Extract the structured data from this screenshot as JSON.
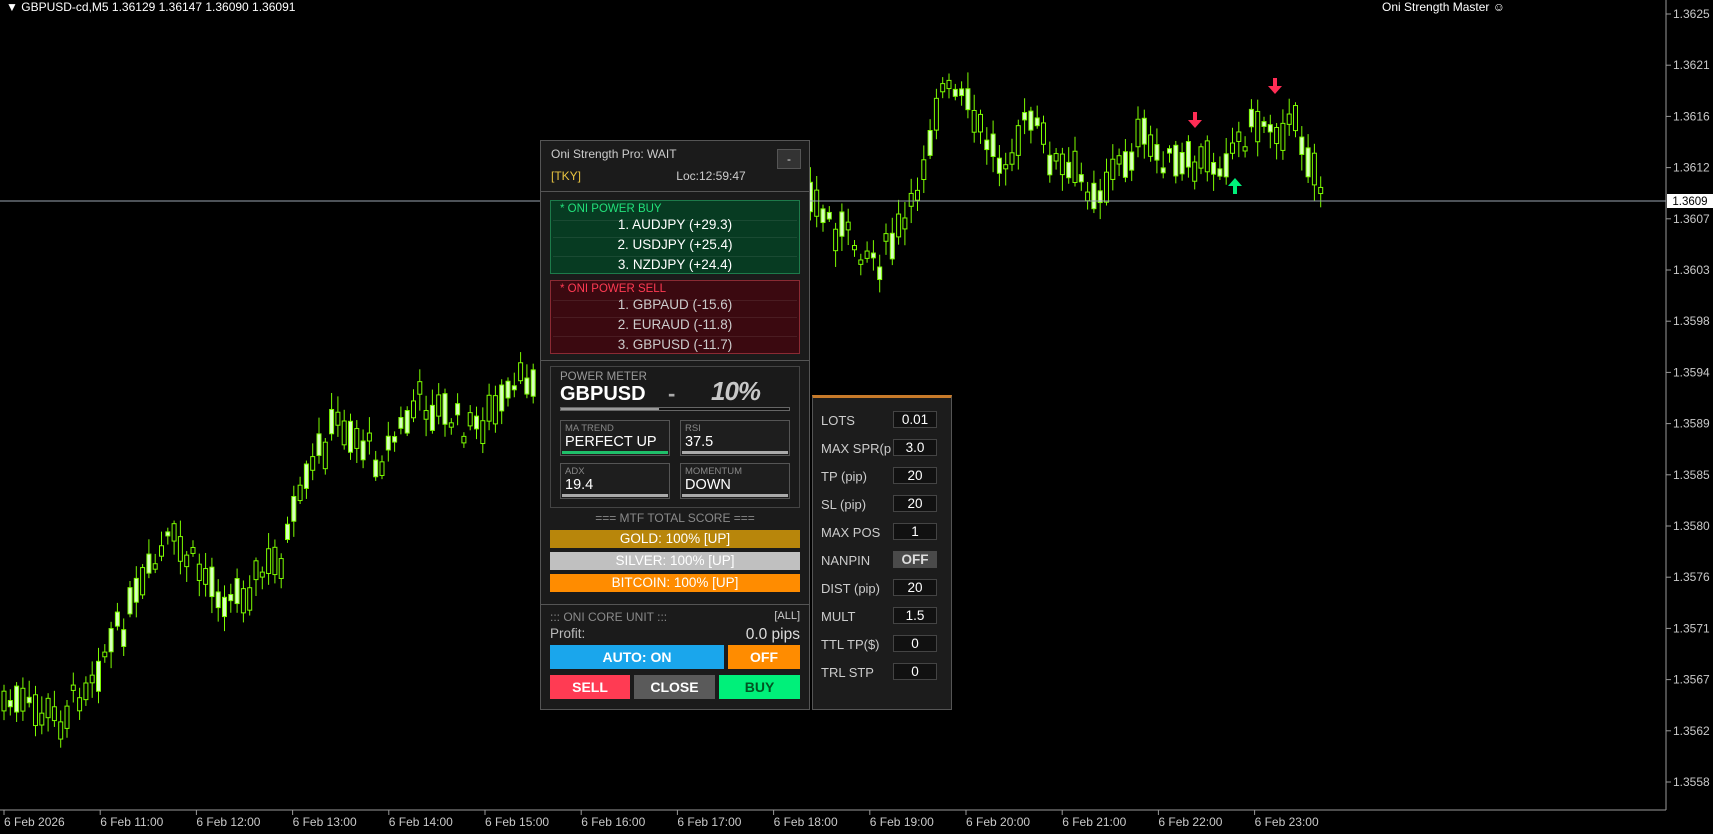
{
  "header": {
    "symbol_info": "GBPUSD-cd,M5  1.36129 1.36147 1.36090 1.36091",
    "ea_name": "Oni Strength Master ☺"
  },
  "price_axis": {
    "ticks": [
      "1.3625",
      "1.3621",
      "1.3616",
      "1.3612",
      "1.3607",
      "1.3603",
      "1.3598",
      "1.3594",
      "1.3589",
      "1.3585",
      "1.3580",
      "1.3576",
      "1.3571",
      "1.3567",
      "1.3562",
      "1.3558"
    ],
    "current": "1.3609"
  },
  "time_axis": {
    "ticks": [
      "6 Feb 2026",
      "6 Feb 11:00",
      "6 Feb 12:00",
      "6 Feb 13:00",
      "6 Feb 14:00",
      "6 Feb 15:00",
      "6 Feb 16:00",
      "6 Feb 17:00",
      "6 Feb 18:00",
      "6 Feb 19:00",
      "6 Feb 20:00",
      "6 Feb 21:00",
      "6 Feb 22:00",
      "6 Feb 23:00"
    ]
  },
  "colors": {
    "candle": "#7CFC00",
    "candle_body": "#d8ffc0",
    "sell_arrow": "#ff2d55",
    "buy_arrow": "#00f07a",
    "price_line": "#9aa4b0"
  },
  "panel": {
    "title": "Oni Strength Pro: WAIT",
    "minimize_label": "-",
    "session": "[TKY]",
    "clock": "Loc:12:59:47",
    "power_buy": {
      "title": "* ONI POWER BUY",
      "items": [
        "1. AUDJPY (+29.3)",
        "2. USDJPY (+25.4)",
        "3. NZDJPY (+24.4)"
      ]
    },
    "power_sell": {
      "title": "* ONI POWER SELL",
      "items": [
        "1. GBPAUD (-15.6)",
        "2. EURAUD (-11.8)",
        "3. GBPUSD (-11.7)"
      ]
    },
    "power_meter": {
      "label": "POWER METER",
      "symbol": "GBPUSD",
      "dash": "-",
      "value": "10%",
      "level": 0.43
    },
    "indicators": {
      "ma_trend": {
        "label": "MA TREND",
        "value": "PERFECT UP"
      },
      "rsi": {
        "label": "RSI",
        "value": "37.5"
      },
      "adx": {
        "label": "ADX",
        "value": "19.4"
      },
      "momentum": {
        "label": "MOMENTUM",
        "value": "DOWN"
      }
    },
    "mtf": {
      "title": "=== MTF TOTAL SCORE ===",
      "gold": "GOLD: 100% [UP]",
      "silver": "SILVER: 100% [UP]",
      "bitcoin": "BITCOIN: 100% [UP]"
    },
    "core": {
      "title": "::: ONI CORE UNIT :::",
      "all_label": "[ALL]",
      "profit_label": "Profit:",
      "profit_value": "0.0 pips",
      "auto_label": "AUTO: ON",
      "off_label": "OFF",
      "sell_label": "SELL",
      "close_label": "CLOSE",
      "buy_label": "BUY"
    }
  },
  "settings": {
    "lots": {
      "label": "LOTS",
      "value": "0.01"
    },
    "max_spread": {
      "label": "MAX SPR(p",
      "value": "3.0"
    },
    "tp": {
      "label": "TP (pip)",
      "value": "20"
    },
    "sl": {
      "label": "SL (pip)",
      "value": "20"
    },
    "max_pos": {
      "label": "MAX POS",
      "value": "1"
    },
    "nanpin": {
      "label": "NANPIN",
      "value": "OFF"
    },
    "dist": {
      "label": "DIST (pip)",
      "value": "20"
    },
    "mult": {
      "label": "MULT",
      "value": "1.5"
    },
    "ttl_tp": {
      "label": "TTL TP($)",
      "value": "0"
    },
    "trl_stp": {
      "label": "TRL STP",
      "value": "0"
    }
  }
}
